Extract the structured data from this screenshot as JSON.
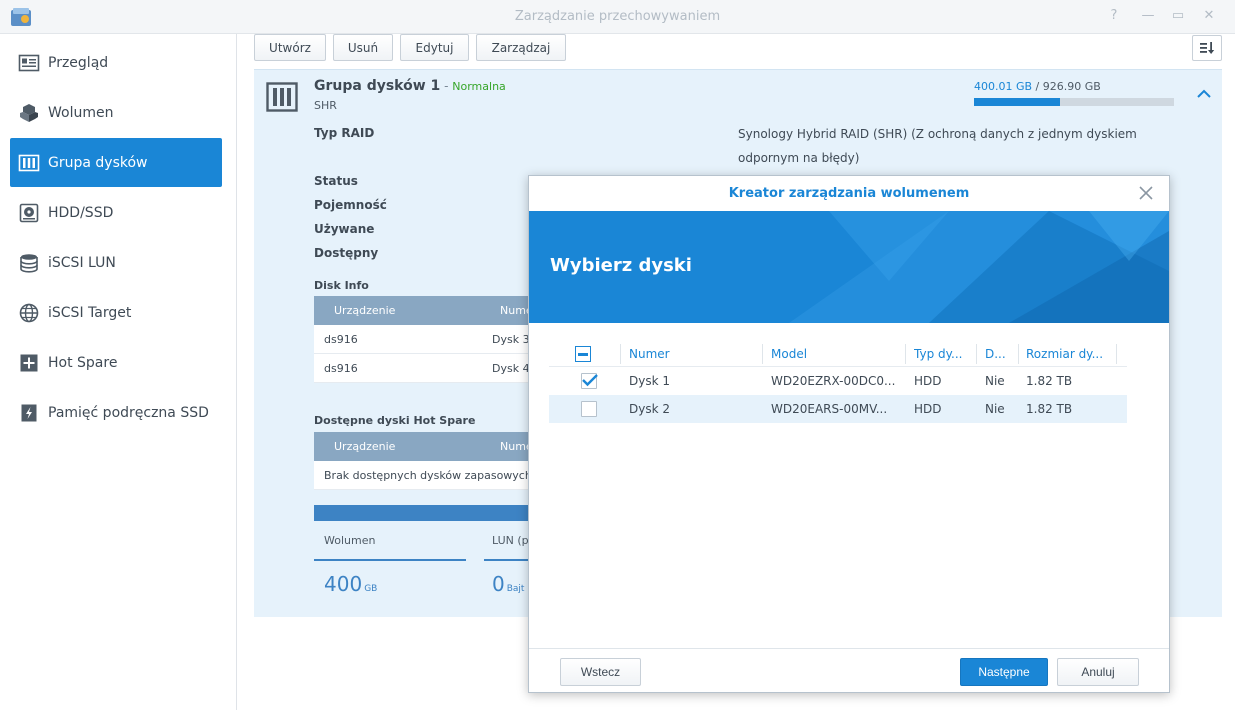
{
  "window": {
    "title": "Zarządzanie przechowywaniem",
    "controls": [
      "?",
      "—",
      "▭",
      "✕"
    ]
  },
  "sidebar": {
    "items": [
      {
        "label": "Przegląd",
        "icon": "overview-icon",
        "active": false
      },
      {
        "label": "Wolumen",
        "icon": "volume-icon",
        "active": false
      },
      {
        "label": "Grupa dysków",
        "icon": "disk-group-icon",
        "active": true
      },
      {
        "label": "HDD/SSD",
        "icon": "hdd-icon",
        "active": false
      },
      {
        "label": "iSCSI LUN",
        "icon": "iscsi-lun-icon",
        "active": false
      },
      {
        "label": "iSCSI Target",
        "icon": "iscsi-target-icon",
        "active": false
      },
      {
        "label": "Hot Spare",
        "icon": "hot-spare-icon",
        "active": false
      },
      {
        "label": "Pamięć podręczna SSD",
        "icon": "ssd-cache-icon",
        "active": false
      }
    ]
  },
  "toolbar": {
    "create": "Utwórz",
    "delete": "Usuń",
    "edit": "Edytuj",
    "manage": "Zarządzaj"
  },
  "pool": {
    "name": "Grupa dysków 1",
    "separator": " - ",
    "status": "Normalna",
    "type": "SHR",
    "used": "400.01 GB",
    "slash": " / ",
    "total": "926.90 GB",
    "usage_fraction": 0.432,
    "labels": {
      "raid_type": "Typ RAID",
      "status": "Status",
      "capacity": "Pojemność",
      "used": "Używane",
      "available": "Dostępny"
    },
    "raid_value": "Synology Hybrid RAID (SHR) (Z ochroną danych z jednym dyskiem odpornym na błędy)",
    "disk_info": {
      "title": "Disk Info",
      "headers": [
        "Urządzenie",
        "Nume"
      ],
      "rows": [
        {
          "device": "ds916",
          "number": "Dysk 3"
        },
        {
          "device": "ds916",
          "number": "Dysk 4"
        }
      ]
    },
    "hot_spare": {
      "title": "Dostępne dyski Hot Spare",
      "headers": [
        "Urządzenie",
        "Nume"
      ],
      "empty": "Brak dostępnych dysków zapasowych"
    },
    "stats": {
      "volume_label": "Wolumen",
      "volume_value": "400",
      "volume_unit": "GB",
      "lun_label": "LUN (p",
      "lun_value": "0",
      "lun_unit": "Bajt"
    }
  },
  "modal": {
    "title": "Kreator zarządzania wolumenem",
    "banner_title": "Wybierz dyski",
    "columns": [
      "Numer",
      "Model",
      "Typ dy...",
      "D...",
      "Rozmiar dy..."
    ],
    "rows": [
      {
        "checked": true,
        "number": "Dysk 1",
        "model": "WD20EZRX-00DC0...",
        "type": "HDD",
        "d": "Nie",
        "size": "1.82 TB"
      },
      {
        "checked": false,
        "number": "Dysk 2",
        "model": "WD20EARS-00MV...",
        "type": "HDD",
        "d": "Nie",
        "size": "1.82 TB"
      }
    ],
    "buttons": {
      "back": "Wstecz",
      "next": "Następne",
      "cancel": "Anuluj"
    }
  },
  "colors": {
    "accent": "#1a86d6",
    "status_normal": "#36a629",
    "table_header": "#89a7c2",
    "panel_bg": "#e6f2fb"
  }
}
